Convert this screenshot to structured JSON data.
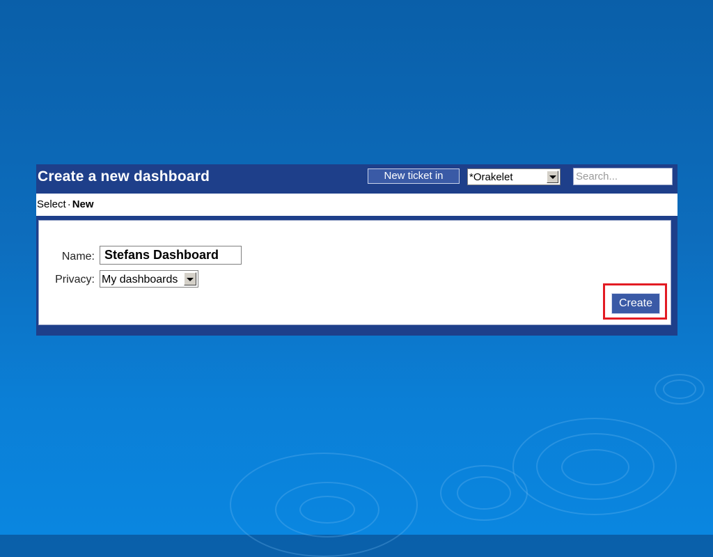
{
  "header": {
    "title": "Create a new dashboard",
    "new_ticket_label": "New ticket in",
    "queue_selected": "*Orakelet",
    "search_placeholder": "Search..."
  },
  "breadcrumb": {
    "parent": "Select",
    "separator": "·",
    "current": "New"
  },
  "form": {
    "name_label": "Name:",
    "name_value": "Stefans Dashboard",
    "privacy_label": "Privacy:",
    "privacy_selected": "My dashboards",
    "submit_label": "Create"
  },
  "colors": {
    "header_bg": "#1e3f8a",
    "button_bg": "#3a5aa6",
    "highlight": "#e31b23",
    "background": "#0b6fc0"
  },
  "icons": {
    "queue_dropdown": "chevron-down-icon",
    "privacy_dropdown": "chevron-down-icon"
  }
}
